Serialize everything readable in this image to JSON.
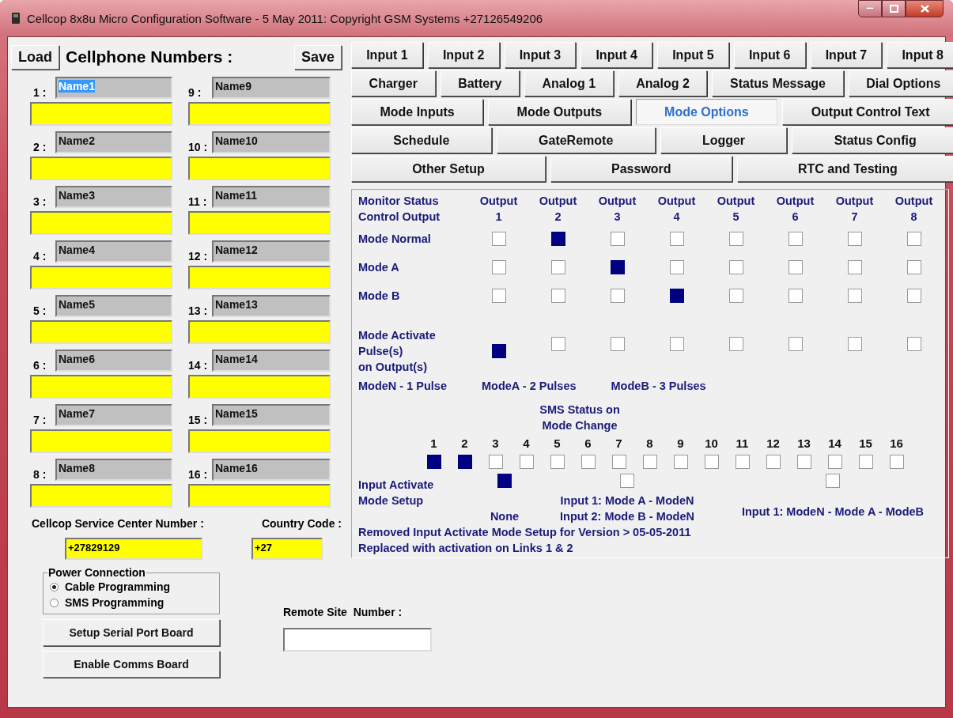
{
  "window": {
    "title": "Cellcop 8x8u Micro Configuration Software - 5 May 2011: Copyright GSM Systems +27126549206"
  },
  "contacts": {
    "load_button": "Load",
    "heading": "Cellphone Numbers :",
    "save_button": "Save",
    "columns": [
      [
        {
          "index": "1 :",
          "name": "Name1",
          "highlighted": true
        },
        {
          "index": "2 :",
          "name": "Name2",
          "highlighted": false
        },
        {
          "index": "3 :",
          "name": "Name3",
          "highlighted": false
        },
        {
          "index": "4 :",
          "name": "Name4",
          "highlighted": false
        },
        {
          "index": "5 :",
          "name": "Name5",
          "highlighted": false
        },
        {
          "index": "6 :",
          "name": "Name6",
          "highlighted": false
        },
        {
          "index": "7 :",
          "name": "Name7",
          "highlighted": false
        },
        {
          "index": "8 :",
          "name": "Name8",
          "highlighted": false
        }
      ],
      [
        {
          "index": "9 :",
          "name": "Name9",
          "highlighted": false
        },
        {
          "index": "10 :",
          "name": "Name10",
          "highlighted": false
        },
        {
          "index": "11 :",
          "name": "Name11",
          "highlighted": false
        },
        {
          "index": "12 :",
          "name": "Name12",
          "highlighted": false
        },
        {
          "index": "13 :",
          "name": "Name13",
          "highlighted": false
        },
        {
          "index": "14 :",
          "name": "Name14",
          "highlighted": false
        },
        {
          "index": "15 :",
          "name": "Name15",
          "highlighted": false
        },
        {
          "index": "16 :",
          "name": "Name16",
          "highlighted": false
        }
      ]
    ]
  },
  "service_center": {
    "label": "Cellcop Service Center Number :",
    "value": "+27829129"
  },
  "country_code": {
    "label": "Country Code :",
    "value": "+27"
  },
  "power_connection": {
    "title": "Power Connection",
    "options": [
      {
        "label": "Cable Programming",
        "selected": true
      },
      {
        "label": "SMS Programming",
        "selected": false
      }
    ]
  },
  "buttons": [
    "Setup Serial Port Board",
    "Enable Comms Board"
  ],
  "remote_site": {
    "label": "Remote Site  Number :"
  },
  "tab_rows": [
    [
      {
        "label": "Input 1",
        "selected": false
      },
      {
        "label": "Input 2",
        "selected": false
      },
      {
        "label": "Input 3",
        "selected": false
      },
      {
        "label": "Input 4",
        "selected": false
      },
      {
        "label": "Input 5",
        "selected": false
      },
      {
        "label": "Input 6",
        "selected": false
      },
      {
        "label": "Input 7",
        "selected": false
      },
      {
        "label": "Input 8",
        "selected": false
      }
    ],
    [
      {
        "label": "Charger",
        "selected": false
      },
      {
        "label": "Battery",
        "selected": false
      },
      {
        "label": "Analog 1",
        "selected": false
      },
      {
        "label": "Analog 2",
        "selected": false
      },
      {
        "label": "Status Message",
        "selected": false
      },
      {
        "label": "Dial Options",
        "selected": false
      }
    ],
    [
      {
        "label": "Mode Inputs",
        "selected": false
      },
      {
        "label": "Mode Outputs",
        "selected": false
      },
      {
        "label": "Mode Options",
        "selected": true
      },
      {
        "label": "Output Control Text",
        "selected": false
      }
    ],
    [
      {
        "label": "Schedule",
        "selected": false
      },
      {
        "label": "GateRemote",
        "selected": false
      },
      {
        "label": "Logger",
        "selected": false
      },
      {
        "label": "Status Config",
        "selected": false
      }
    ],
    [
      {
        "label": "Other Setup",
        "selected": false
      },
      {
        "label": "Password",
        "selected": false
      },
      {
        "label": "RTC and Testing",
        "selected": false
      }
    ]
  ],
  "mode_options": {
    "corner_label": [
      "Monitor Status",
      "Control Output"
    ],
    "outputs": [
      [
        "Output",
        "1"
      ],
      [
        "Output",
        "2"
      ],
      [
        "Output",
        "3"
      ],
      [
        "Output",
        "4"
      ],
      [
        "Output",
        "5"
      ],
      [
        "Output",
        "6"
      ],
      [
        "Output",
        "7"
      ],
      [
        "Output",
        "8"
      ]
    ],
    "rows": [
      {
        "label": [
          "Mode Normal"
        ],
        "checks": [
          false,
          true,
          false,
          false,
          false,
          false,
          false,
          false
        ]
      },
      {
        "label": [
          "Mode A"
        ],
        "checks": [
          false,
          false,
          true,
          false,
          false,
          false,
          false,
          false
        ]
      },
      {
        "label": [
          "Mode B"
        ],
        "checks": [
          false,
          false,
          false,
          true,
          false,
          false,
          false,
          false
        ]
      },
      {
        "label": [
          "Mode Activate",
          "Pulse(s)",
          "on Output(s)"
        ],
        "checks": [
          true,
          false,
          false,
          false,
          false,
          false,
          false,
          false
        ]
      }
    ],
    "pulse_notes": [
      "ModeN - 1 Pulse",
      "ModeA - 2 Pulses",
      "ModeB - 3 Pulses"
    ],
    "sms": {
      "title": [
        "SMS Status on",
        "Mode Change"
      ],
      "links": [
        {
          "number": "1",
          "checked": true
        },
        {
          "number": "2",
          "checked": true
        },
        {
          "number": "3",
          "checked": false
        },
        {
          "number": "4",
          "checked": false
        },
        {
          "number": "5",
          "checked": false
        },
        {
          "number": "6",
          "checked": false
        },
        {
          "number": "7",
          "checked": false
        },
        {
          "number": "8",
          "checked": false
        },
        {
          "number": "9",
          "checked": false
        },
        {
          "number": "10",
          "checked": false
        },
        {
          "number": "11",
          "checked": false
        },
        {
          "number": "12",
          "checked": false
        },
        {
          "number": "13",
          "checked": false
        },
        {
          "number": "14",
          "checked": false
        },
        {
          "number": "15",
          "checked": false
        },
        {
          "number": "16",
          "checked": false
        }
      ]
    },
    "input_activate": {
      "label": [
        "Input Activate",
        "Mode Setup"
      ],
      "options": [
        {
          "label": [
            "None"
          ],
          "checked": true
        },
        {
          "label": [
            "Input 1: Mode A - ModeN",
            "Input 2: Mode B - ModeN"
          ],
          "checked": false
        },
        {
          "label": [
            "Input 1: ModeN - Mode A - ModeB"
          ],
          "checked": false
        }
      ]
    },
    "notes": [
      "Removed Input Activate Mode Setup for Version > 05-05-2011",
      "Replaced with activation on Links 1 & 2"
    ]
  }
}
